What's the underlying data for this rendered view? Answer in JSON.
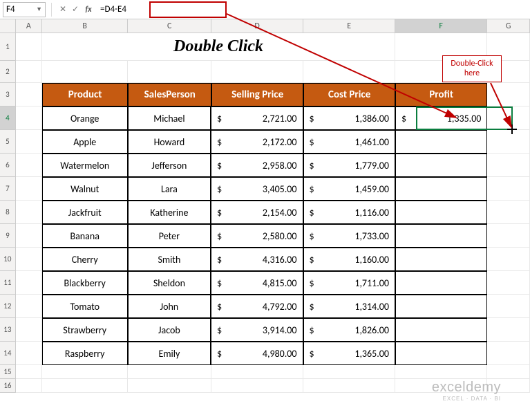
{
  "nameBox": "F4",
  "formula": "=D4-E4",
  "columns": [
    "A",
    "B",
    "C",
    "D",
    "E",
    "F",
    "G"
  ],
  "title": "Double Click",
  "callout": {
    "line1": "Double-Click",
    "line2": "here"
  },
  "headers": {
    "product": "Product",
    "salesPerson": "SalesPerson",
    "sellingPrice": "Selling Price",
    "costPrice": "Cost Price",
    "profit": "Profit"
  },
  "rows": [
    {
      "product": "Orange",
      "sales": "Michael",
      "sell": "2,721.00",
      "cost": "1,386.00",
      "profit": "1,335.00"
    },
    {
      "product": "Apple",
      "sales": "Howard",
      "sell": "2,172.00",
      "cost": "1,461.00",
      "profit": ""
    },
    {
      "product": "Watermelon",
      "sales": "Jefferson",
      "sell": "2,958.00",
      "cost": "1,779.00",
      "profit": ""
    },
    {
      "product": "Walnut",
      "sales": "Lara",
      "sell": "3,405.00",
      "cost": "1,459.00",
      "profit": ""
    },
    {
      "product": "Jackfruit",
      "sales": "Katherine",
      "sell": "2,154.00",
      "cost": "1,116.00",
      "profit": ""
    },
    {
      "product": "Banana",
      "sales": "Peter",
      "sell": "2,580.00",
      "cost": "1,733.00",
      "profit": ""
    },
    {
      "product": "Cherry",
      "sales": "Smith",
      "sell": "4,316.00",
      "cost": "1,160.00",
      "profit": ""
    },
    {
      "product": "Blackberry",
      "sales": "Sheldon",
      "sell": "4,815.00",
      "cost": "1,711.00",
      "profit": ""
    },
    {
      "product": "Tomato",
      "sales": "John",
      "sell": "4,792.00",
      "cost": "1,314.00",
      "profit": ""
    },
    {
      "product": "Strawberry",
      "sales": "Jacob",
      "sell": "3,914.00",
      "cost": "1,826.00",
      "profit": ""
    },
    {
      "product": "Raspberry",
      "sales": "Emily",
      "sell": "4,980.00",
      "cost": "1,365.00",
      "profit": ""
    }
  ],
  "currency": "$",
  "rowNumbers": [
    "1",
    "2",
    "3",
    "4",
    "5",
    "6",
    "7",
    "8",
    "9",
    "10",
    "11",
    "12",
    "13",
    "14",
    "15",
    "16"
  ],
  "watermark": {
    "main": "exceldemy",
    "sub": "EXCEL · DATA · BI"
  }
}
